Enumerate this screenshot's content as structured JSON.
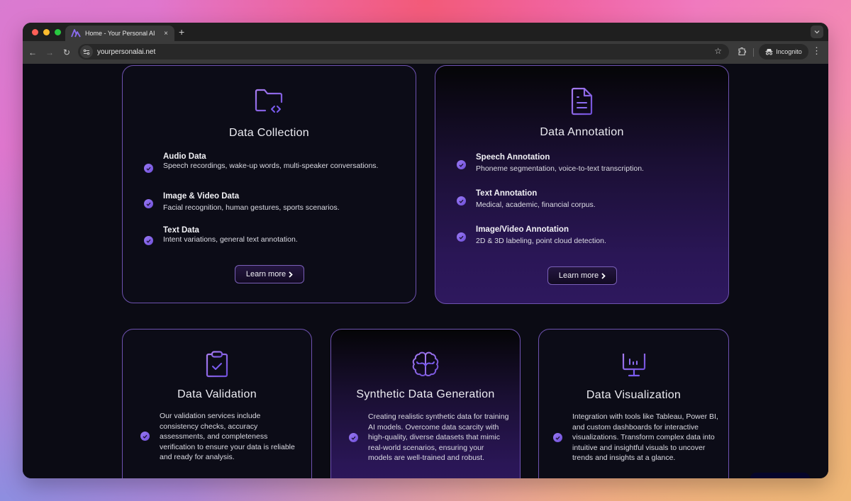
{
  "browser": {
    "tab_title": "Home - Your Personal AI",
    "tab_close": "×",
    "new_tab": "+",
    "url": "yourpersonalai.net",
    "incognito_label": "Incognito",
    "back": "←",
    "forward": "→",
    "reload": "↻",
    "star": "☆",
    "menu": "⋮",
    "tab_menu": "⌄"
  },
  "cards_top": [
    {
      "title": "Data Collection",
      "icon": "folder-code-icon",
      "items": [
        {
          "title": "Audio Data",
          "desc": "Speech recordings, wake-up words, multi-speaker conversations."
        },
        {
          "title": "Image & Video Data",
          "desc": "Facial recognition, human gestures, sports scenarios."
        },
        {
          "title": "Text Data",
          "desc": "Intent variations, general text annotation."
        }
      ],
      "button": "Learn more"
    },
    {
      "title": "Data Annotation",
      "icon": "document-icon",
      "items": [
        {
          "title": "Speech Annotation",
          "desc": "Phoneme segmentation, voice-to-text transcription."
        },
        {
          "title": "Text Annotation",
          "desc": "Medical, academic, financial corpus."
        },
        {
          "title": "Image/Video Annotation",
          "desc": "2D & 3D labeling, point cloud detection."
        }
      ],
      "button": "Learn more"
    }
  ],
  "cards_bottom": [
    {
      "title": "Data Validation",
      "icon": "clipboard-check-icon",
      "desc": "Our validation services include consistency checks, accuracy assessments, and completeness verification to ensure your data is reliable and ready for analysis."
    },
    {
      "title": "Synthetic Data Generation",
      "icon": "brain-icon",
      "desc": "Creating realistic synthetic data for training AI models. Overcome data scarcity with high-quality, diverse datasets that mimic real-world scenarios, ensuring your models are well-trained and robust."
    },
    {
      "title": "Data Visualization",
      "icon": "presentation-chart-icon",
      "desc": "Integration with tools like Tableau, Power BI, and custom dashboards for interactive visualizations. Transform complex data into intuitive and insightful visuals to uncover trends and insights at a glance."
    }
  ],
  "colors": {
    "accent": "#8b6cf0",
    "card_border": "#6e52b0",
    "page_bg": "#0b0b14"
  }
}
